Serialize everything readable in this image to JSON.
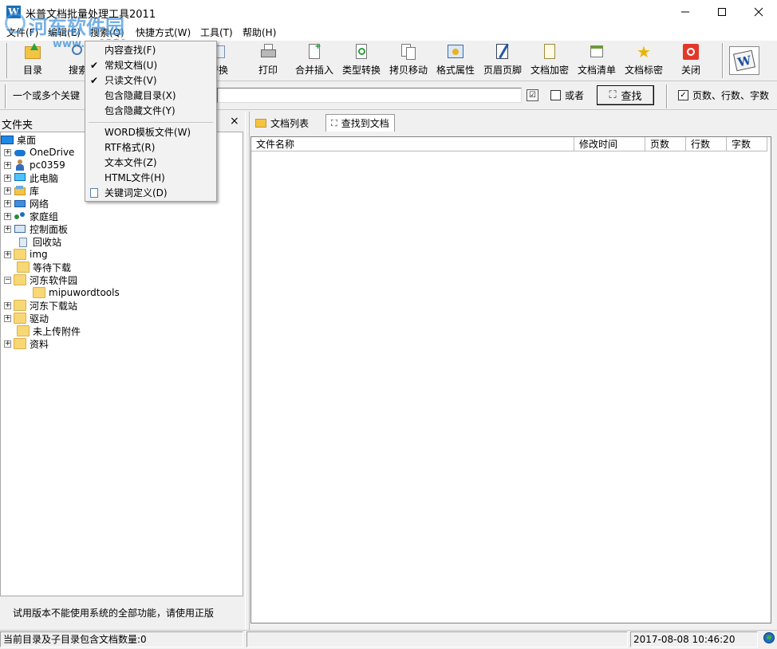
{
  "window": {
    "title": "米普文档批量处理工具2011"
  },
  "watermark": {
    "line1": "河东软件园",
    "line2": "www.pc0359.cn"
  },
  "menubar": [
    "文件(F)",
    "编辑(E)",
    "搜索(Q)",
    "快捷方式(W)",
    "工具(T)",
    "帮助(H)"
  ],
  "toolbar": {
    "items": [
      "目录",
      "搜索",
      "替换",
      "打印",
      "合并插入",
      "类型转换",
      "拷贝移动",
      "格式属性",
      "页眉页脚",
      "文档加密",
      "文档清单",
      "文档标密",
      "关闭"
    ]
  },
  "search": {
    "keywords_label": "一个或多个关键",
    "keywords_value": "",
    "or_label": "或者",
    "find_label": "查找",
    "stats_label": "页数、行数、字数"
  },
  "search_menu": {
    "items": [
      {
        "label": "内容查找(F)",
        "checked": false
      },
      {
        "label": "常规文档(U)",
        "checked": true
      },
      {
        "label": "只读文件(V)",
        "checked": true
      },
      {
        "label": "包含隐藏目录(X)",
        "checked": false
      },
      {
        "label": "包含隐藏文件(Y)",
        "checked": false
      },
      {
        "label": "WORD模板文件(W)",
        "checked": false
      },
      {
        "label": "RTF格式(R)",
        "checked": false
      },
      {
        "label": "文本文件(Z)",
        "checked": false
      },
      {
        "label": "HTML文件(H)",
        "checked": false
      },
      {
        "label": "关键词定义(D)",
        "checked": false
      }
    ]
  },
  "left_panel": {
    "header": "文件夹",
    "close": "×",
    "tree": [
      "桌面",
      "OneDrive",
      "pc0359",
      "此电脑",
      "库",
      "网络",
      "家庭组",
      "控制面板",
      "回收站",
      "img",
      "等待下载",
      "河东软件园",
      "mipuwordtools",
      "河东下载站",
      "驱动",
      "未上传附件",
      "资料"
    ],
    "trial_message": "试用版本不能使用系统的全部功能，请使用正版"
  },
  "right_panel": {
    "tabs": [
      "文档列表",
      "查找到文档"
    ],
    "columns": [
      "文件名称",
      "修改时间",
      "页数",
      "行数",
      "字数"
    ]
  },
  "statusbar": {
    "doc_count": "当前目录及子目录包含文档数量:0",
    "datetime": "2017-08-08 10:46:20"
  }
}
